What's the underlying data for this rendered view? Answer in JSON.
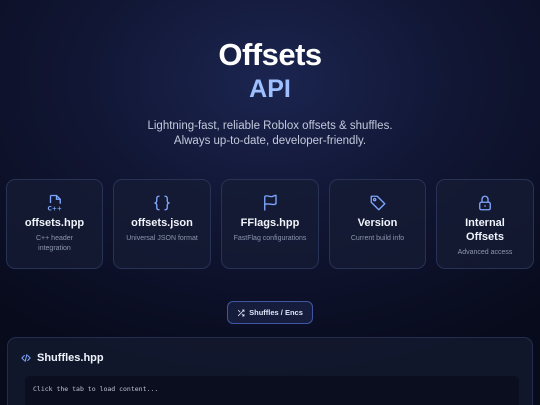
{
  "hero": {
    "title": "Offsets",
    "subtitle": "API",
    "description_line1": "Lightning-fast, reliable Roblox offsets & shuffles.",
    "description_line2": "Always up-to-date, developer-friendly."
  },
  "cards": [
    {
      "icon": "cpp-file-icon",
      "title": "offsets.hpp",
      "desc_line1": "C++ header",
      "desc_line2": "integration"
    },
    {
      "icon": "braces-icon",
      "title": "offsets.json",
      "desc_line1": "Universal JSON format"
    },
    {
      "icon": "flag-icon",
      "title": "FFlags.hpp",
      "desc_line1": "FastFlag configurations"
    },
    {
      "icon": "tag-icon",
      "title": "Version",
      "desc_line1": "Current build info"
    },
    {
      "icon": "lock-icon",
      "title_line1": "Internal",
      "title_line2": "Offsets",
      "desc_line1": "Advanced access"
    }
  ],
  "tab": {
    "label": "Shuffles / Encs",
    "icon": "shuffle-icon"
  },
  "panel": {
    "icon": "code-icon",
    "title": "Shuffles.hpp",
    "content": "Click the tab to load content..."
  },
  "colors": {
    "accent": "#7fa6ff",
    "subtitle": "#9ec0ff",
    "background": "#0b0f24",
    "card": "#161c34"
  }
}
